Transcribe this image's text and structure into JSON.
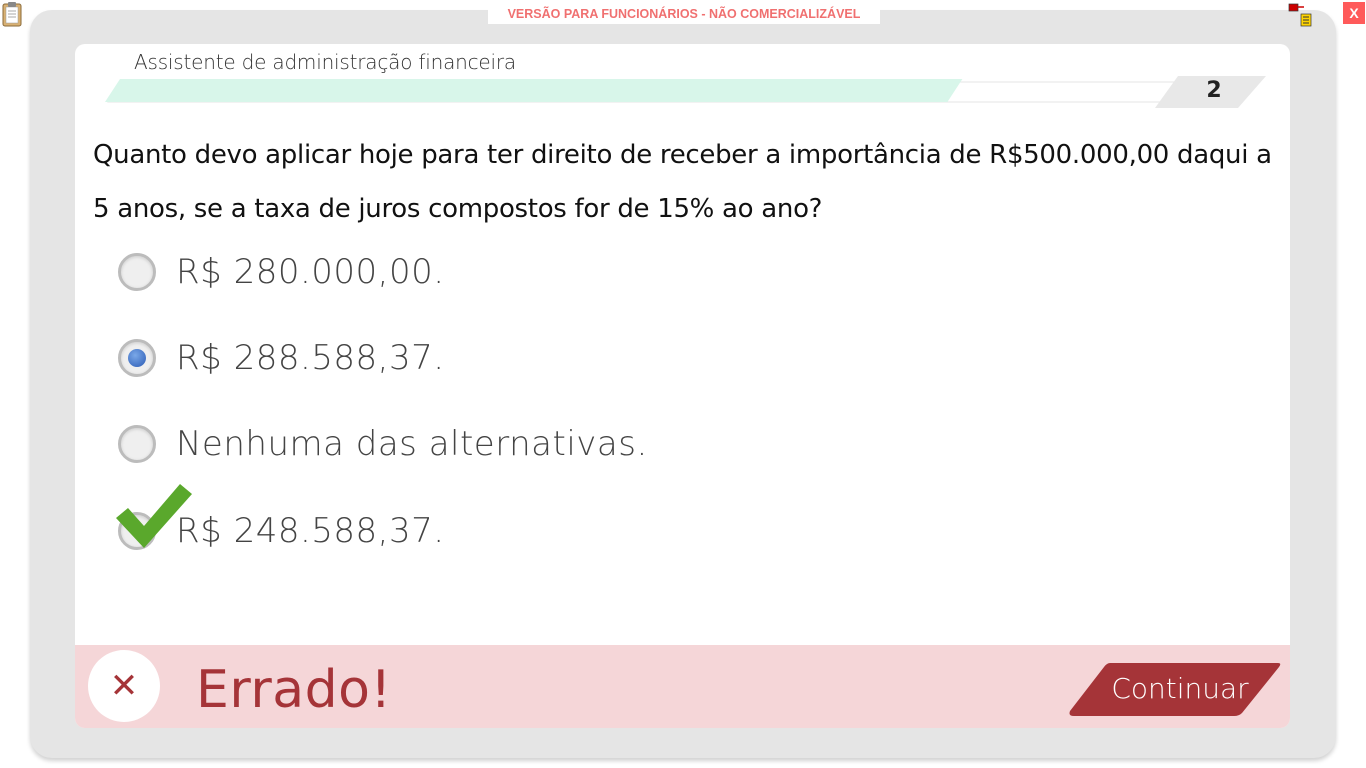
{
  "window": {
    "warning_banner": "VERSÃO PARA FUNCIONÁRIOS - NÃO COMERCIALIZÁVEL",
    "close_label": "X"
  },
  "header": {
    "title": "Assistente de administração financeira",
    "question_number": "2",
    "progress": 0.78
  },
  "question": {
    "text": "Quanto devo aplicar hoje para ter direito de receber a importância de R$500.000,00 daqui a 5 anos, se a taxa de juros compostos for de 15% ao ano?"
  },
  "options": [
    {
      "label": "R$ 280.000,00.",
      "selected": false,
      "correct": false
    },
    {
      "label": "R$ 288.588,37.",
      "selected": true,
      "correct": false
    },
    {
      "label": "Nenhuma das alternativas.",
      "selected": false,
      "correct": false
    },
    {
      "label": "R$ 248.588,37.",
      "selected": false,
      "correct": true
    }
  ],
  "feedback": {
    "status_text": "Errado!",
    "status_icon": "close-icon",
    "continue_label": "Continuar"
  },
  "colors": {
    "error": "#a53438",
    "feedback_bg": "#f5d6d8",
    "progress_fill": "#d8f6ea",
    "check": "#5aa82c",
    "warning_text": "#f07070",
    "close_bg": "#ff5a5a"
  }
}
